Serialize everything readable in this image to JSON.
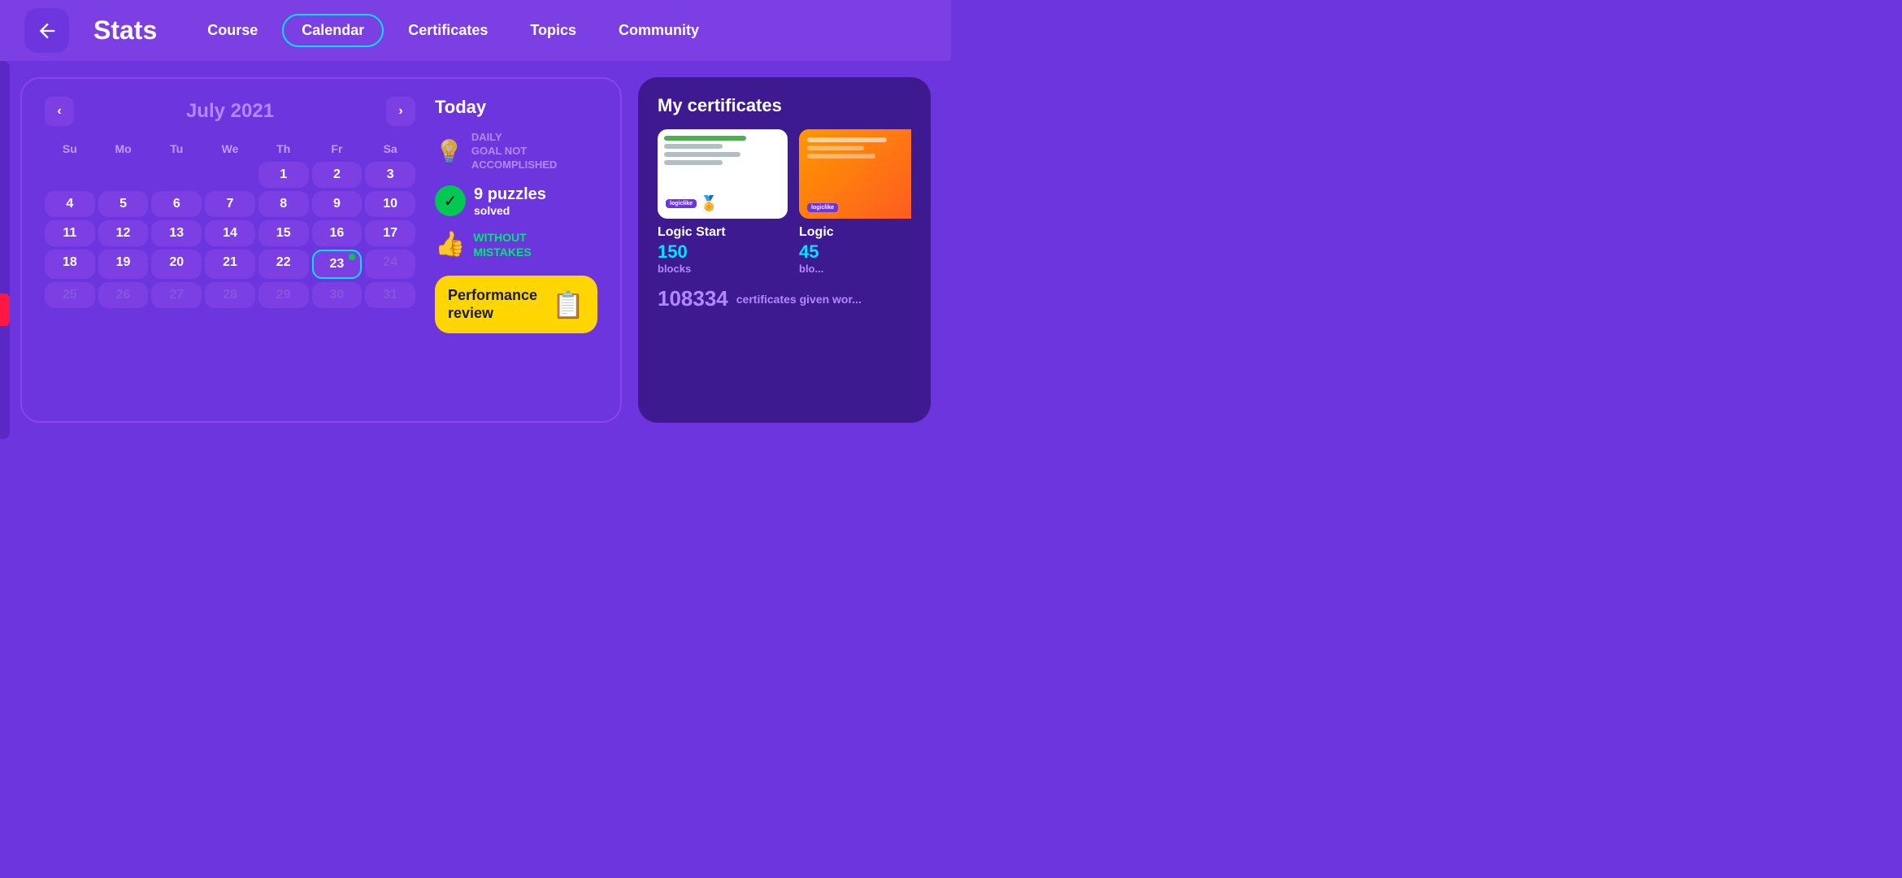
{
  "header": {
    "title": "Stats",
    "nav": [
      {
        "label": "Course",
        "active": false
      },
      {
        "label": "Calendar",
        "active": true
      },
      {
        "label": "Certificates",
        "active": false
      },
      {
        "label": "Topics",
        "active": false
      },
      {
        "label": "Community",
        "active": false
      }
    ]
  },
  "calendar": {
    "month": "July",
    "year": "2021",
    "dayHeaders": [
      "Su",
      "Mo",
      "Tu",
      "We",
      "Th",
      "Fr",
      "Sa"
    ],
    "weeks": [
      [
        "",
        "",
        "",
        "",
        "1",
        "2",
        "3"
      ],
      [
        "4",
        "5",
        "6",
        "7",
        "8",
        "9",
        "10"
      ],
      [
        "11",
        "12",
        "13",
        "14",
        "15",
        "16",
        "17"
      ],
      [
        "18",
        "19",
        "20",
        "21",
        "22",
        "23",
        "24"
      ],
      [
        "25",
        "26",
        "27",
        "28",
        "29",
        "30",
        "31"
      ]
    ],
    "today": "23"
  },
  "today": {
    "title": "Today",
    "goalText": "DAILY\nGOAL NOT\nACCOMPLISHED",
    "puzzlesCount": "9",
    "puzzlesLabel": "puzzles",
    "puzzlesSub": "solved",
    "mistakesLabel": "WITHOUT\nMISTAKES",
    "performanceBtn": "Performance\nreview"
  },
  "certificates": {
    "title": "My certificates",
    "cards": [
      {
        "name": "Logic Start",
        "blocks": "150",
        "blocksLabel": "blocks"
      },
      {
        "name": "Logic",
        "blocks": "45",
        "blocksLabel": "blo..."
      }
    ],
    "countNumber": "108334",
    "countText": "certificates given wor..."
  }
}
